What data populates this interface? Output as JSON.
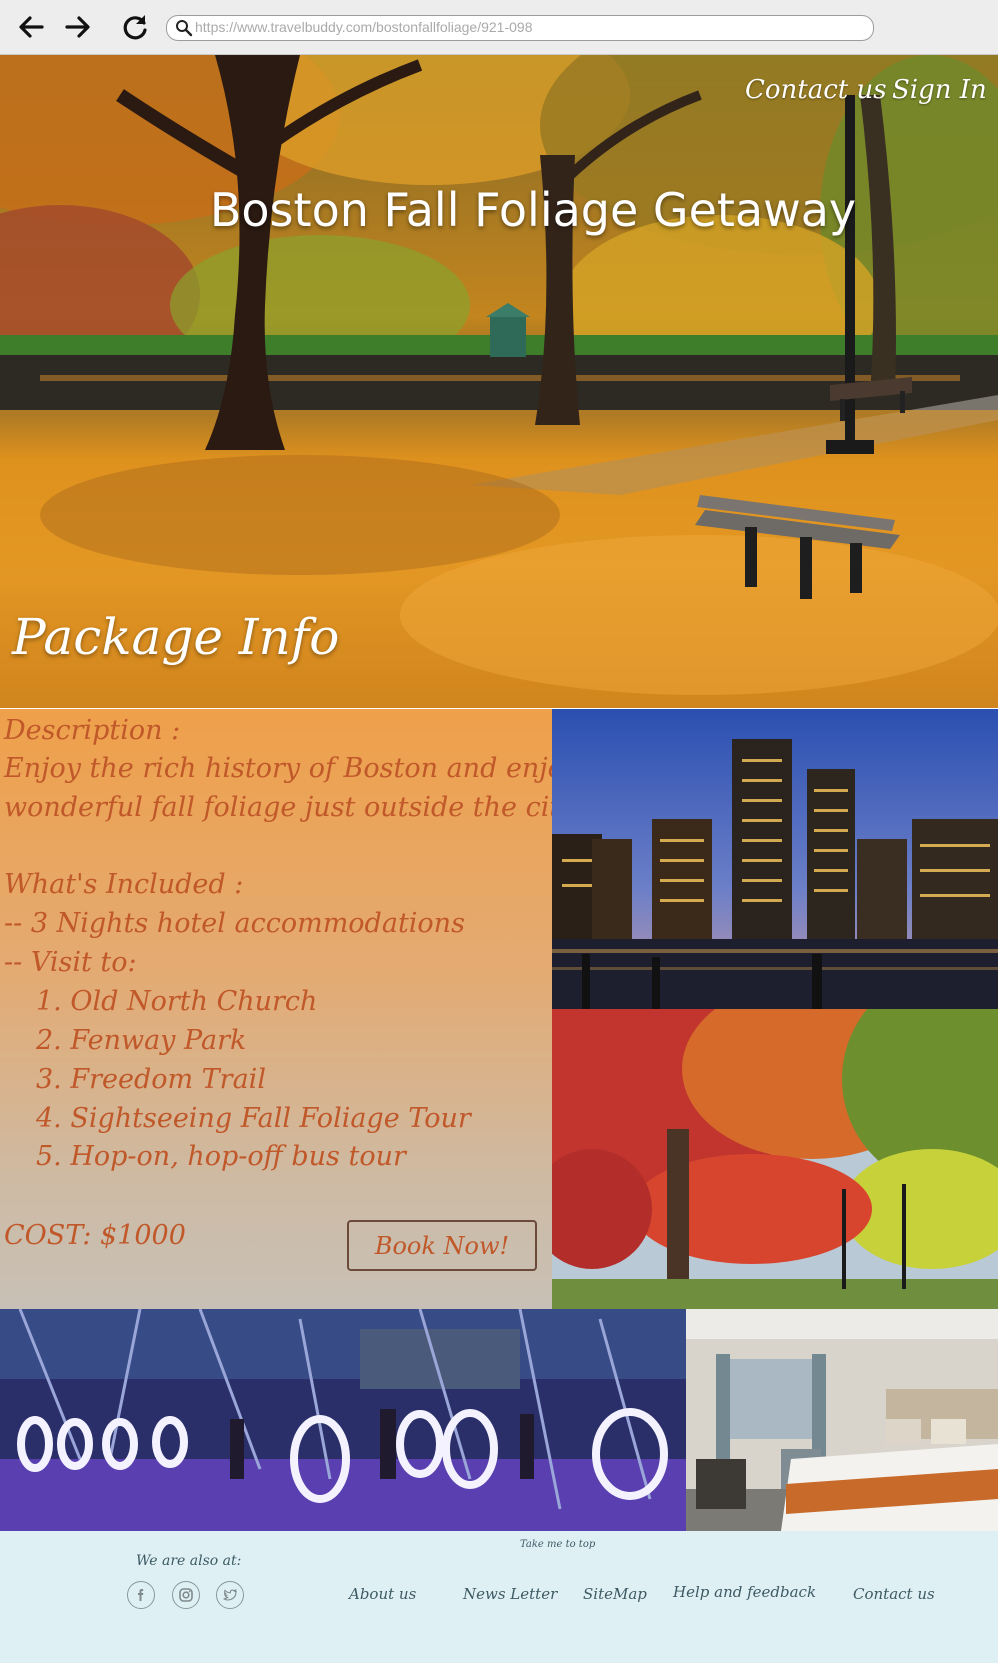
{
  "browser": {
    "url": "https://www.travelbuddy.com/bostonfallfoliage/921-098",
    "icons": [
      "back-arrow-icon",
      "forward-arrow-icon",
      "reload-icon",
      "search-icon"
    ]
  },
  "header": {
    "contact_label": "Contact us",
    "signin_label": "Sign In",
    "title": "Boston Fall Foliage Getaway",
    "section_label": "Package Info"
  },
  "package": {
    "description_heading": "Description :",
    "description_line1": "Enjoy the rich history of Boston and enjoy the",
    "description_line2": "wonderful fall foliage just outside the city",
    "included_heading": "What's Included :",
    "included_hotel": "-- 3 Nights hotel accommodations",
    "included_visit": "-- Visit to:",
    "visits": [
      "1. Old North Church",
      "2. Fenway Park",
      "3. Freedom Trail",
      "4. Sightseeing Fall Foliage Tour",
      "5. Hop-on, hop-off bus tour"
    ],
    "cost": "COST: $1000",
    "book_label": "Book Now!"
  },
  "footer": {
    "take_top": "Take me to top",
    "also_at": "We are also at:",
    "social": [
      "facebook-icon",
      "instagram-icon",
      "twitter-icon"
    ],
    "links": [
      "About us",
      "News Letter",
      "SiteMap",
      "Help and feedback",
      "Contact us"
    ]
  },
  "colors": {
    "panel_text": "#c0582a",
    "footer_bg": "#dff0f5",
    "footer_text": "#3d5a63"
  }
}
